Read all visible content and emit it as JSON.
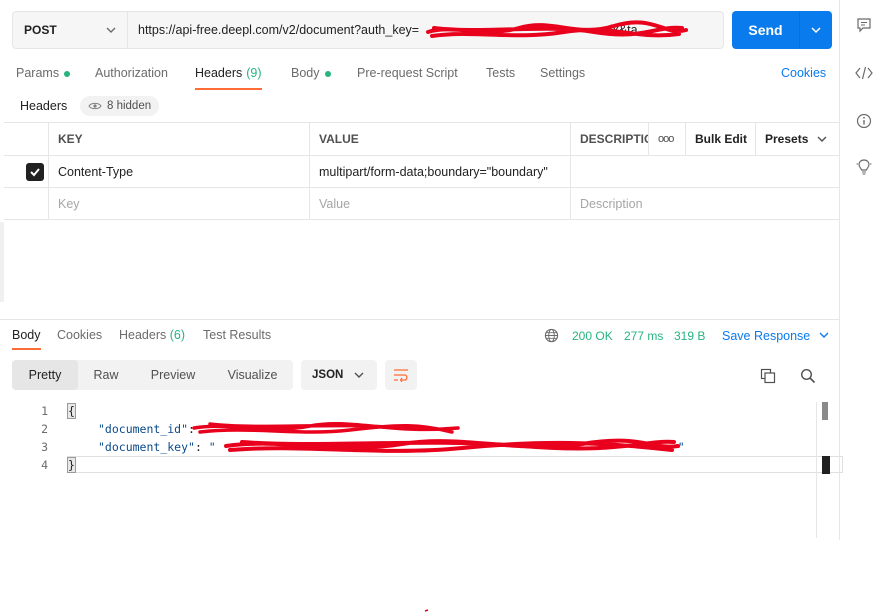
{
  "request": {
    "method": "POST",
    "url": "https://api-free.deepl.com/v2/document?auth_key=",
    "url_tail": "fx&ta...",
    "send_label": "Send"
  },
  "request_tabs": {
    "params": "Params",
    "authorization": "Authorization",
    "headers": "Headers",
    "headers_count": "(9)",
    "body": "Body",
    "prerequest": "Pre-request Script",
    "tests": "Tests",
    "settings": "Settings",
    "cookies": "Cookies"
  },
  "headers_section": {
    "title": "Headers",
    "hidden": "8 hidden"
  },
  "headers_table": {
    "columns": {
      "key": "KEY",
      "value": "VALUE",
      "description": "DESCRIPTIC",
      "more": "ooo",
      "bulk_edit": "Bulk Edit",
      "presets": "Presets"
    },
    "rows": [
      {
        "checked": true,
        "key": "Content-Type",
        "value": "multipart/form-data;boundary=\"boundary\"",
        "description": ""
      }
    ],
    "placeholders": {
      "key": "Key",
      "value": "Value",
      "description": "Description"
    }
  },
  "response_tabs": {
    "body": "Body",
    "cookies": "Cookies",
    "headers": "Headers",
    "headers_count": "(6)",
    "test_results": "Test Results"
  },
  "response_status": {
    "status": "200 OK",
    "time": "277 ms",
    "size": "319 B",
    "save": "Save Response"
  },
  "response_view": {
    "pretty": "Pretty",
    "raw": "Raw",
    "preview": "Preview",
    "visualize": "Visualize",
    "format": "JSON"
  },
  "code": {
    "line_numbers": [
      "1",
      "2",
      "3",
      "4"
    ],
    "open": "{",
    "key1": "\"document_id\"",
    "key2": "\"document_key\"",
    "val2_prefix": "\"",
    "val2_suffix": "\"",
    "close": "}"
  },
  "colors": {
    "accent": "#097bed",
    "active_tab": "#ff6c37",
    "success": "#26b47f",
    "redaction": "#e8001c"
  },
  "icons": [
    "chevron-down-icon",
    "globe-icon",
    "wrap-lines-icon",
    "copy-icon",
    "search-icon",
    "comments-icon",
    "code-icon",
    "info-icon",
    "lightbulb-icon"
  ]
}
